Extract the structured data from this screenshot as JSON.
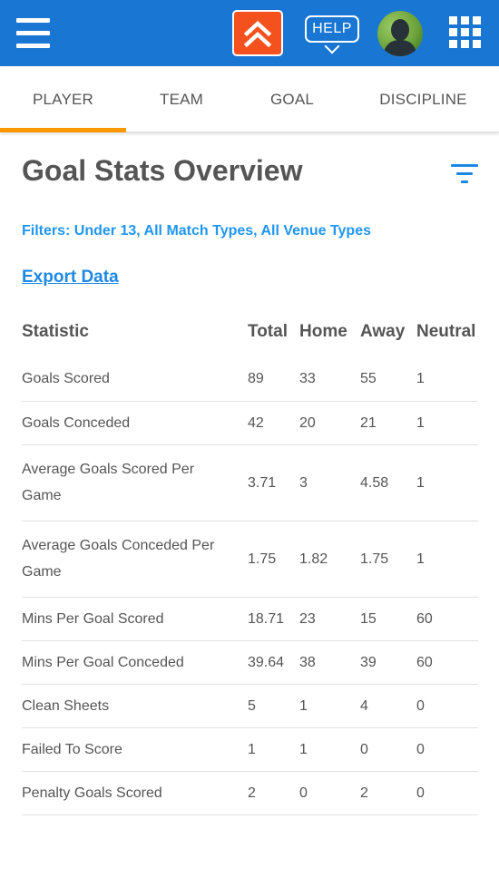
{
  "header": {
    "menu_icon": "hamburger-menu-icon",
    "logo_icon": "double-chevron-up-icon",
    "logo_color": "#f4511e",
    "help_label": "HELP",
    "avatar_icon": "user-avatar",
    "apps_icon": "apps-grid-icon",
    "bar_color": "#1976d2"
  },
  "tabs": [
    {
      "label": "PLAYER",
      "active": true
    },
    {
      "label": "TEAM",
      "active": false
    },
    {
      "label": "GOAL",
      "active": false
    },
    {
      "label": "DISCIPLINE",
      "active": false
    }
  ],
  "tab_indicator_color": "#ff9800",
  "page": {
    "title": "Goal Stats Overview",
    "filter_icon": "filter-icon",
    "filters_text": "Filters: Under 13, All Match Types, All Venue Types",
    "export_label": "Export Data"
  },
  "table": {
    "headers": [
      "Statistic",
      "Total",
      "Home",
      "Away",
      "Neutral"
    ],
    "rows": [
      [
        "Goals Scored",
        "89",
        "33",
        "55",
        "1"
      ],
      [
        "Goals Conceded",
        "42",
        "20",
        "21",
        "1"
      ],
      [
        "Average Goals Scored Per Game",
        "3.71",
        "3",
        "4.58",
        "1"
      ],
      [
        "Average Goals Conceded Per Game",
        "1.75",
        "1.82",
        "1.75",
        "1"
      ],
      [
        "Mins Per Goal Scored",
        "18.71",
        "23",
        "15",
        "60"
      ],
      [
        "Mins Per Goal Conceded",
        "39.64",
        "38",
        "39",
        "60"
      ],
      [
        "Clean Sheets",
        "5",
        "1",
        "4",
        "0"
      ],
      [
        "Failed To Score",
        "1",
        "1",
        "0",
        "0"
      ],
      [
        "Penalty Goals Scored",
        "2",
        "0",
        "2",
        "0"
      ]
    ]
  }
}
